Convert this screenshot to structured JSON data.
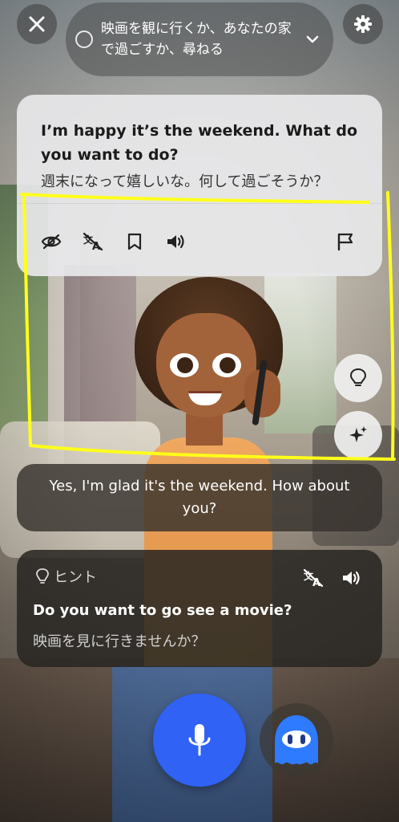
{
  "header": {
    "goal_text": "映画を観に行くか、あなたの家で過ごすか、尋ねる"
  },
  "ai_message": {
    "english": "I’m happy it’s the weekend. What do you want to do?",
    "japanese": "週末になって嬉しいな。何して過ごそうか？"
  },
  "user_message": {
    "text": "Yes, I'm glad it's the weekend. How about you?"
  },
  "hint": {
    "label": "ヒント",
    "english": "Do you want to go see a movie?",
    "japanese": "映画を見に行きませんか？"
  },
  "colors": {
    "mic_button": "#2f62f5",
    "annotation": "#ffff1a"
  },
  "icons": [
    "close-icon",
    "gear-icon",
    "chevron-down-icon",
    "eye-off-icon",
    "translate-off-icon",
    "bookmark-icon",
    "speaker-icon",
    "flag-icon",
    "lightbulb-icon",
    "sparkle-icon",
    "mic-icon",
    "ghost-avatar-icon"
  ]
}
